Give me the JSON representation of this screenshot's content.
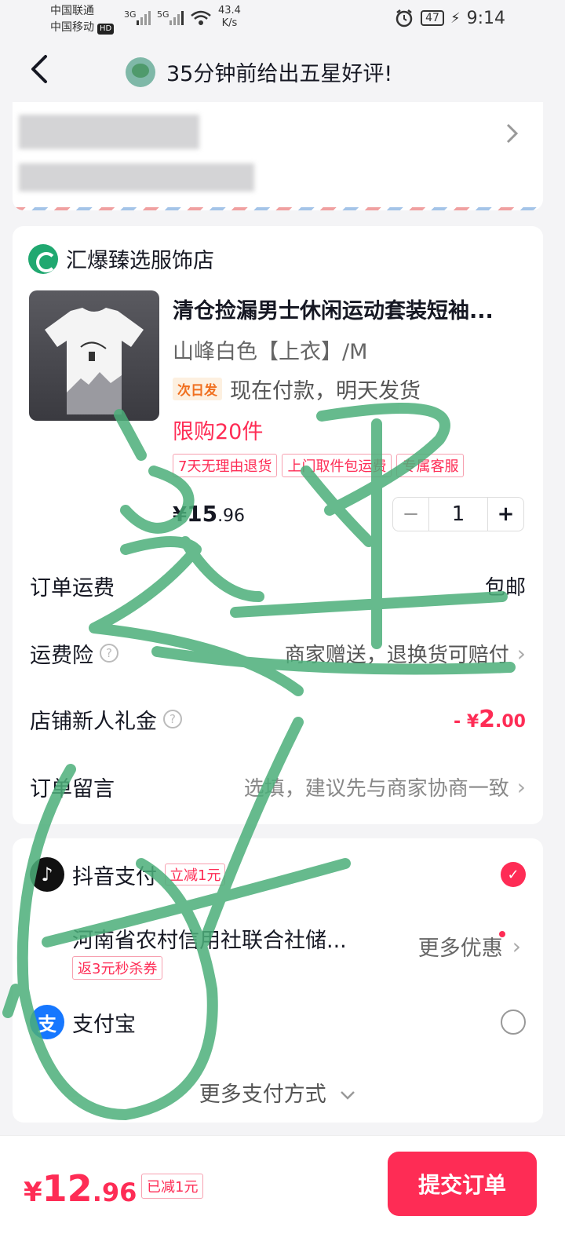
{
  "status_bar": {
    "carrier_1": "中国联通",
    "carrier_2": "中国移动",
    "hd_badge": "HD",
    "net_1": "3G",
    "net_2": "5G",
    "speed_value": "43.4",
    "speed_unit": "K/s",
    "battery": "47",
    "time": "9:14"
  },
  "nav": {
    "title": "35分钟前给出五星好评!"
  },
  "shop": {
    "name": "汇爆臻选服饰店",
    "product": {
      "title": "清仓捡漏男士休闲运动套装短袖...",
      "spec": "山峰白色【上衣】/M",
      "shipping_badge": "次日发",
      "shipping_text": "现在付款，明天发货",
      "limit": "限购20件",
      "tags": [
        "7天无理由退货",
        "上门取件包运费",
        "专属客服"
      ],
      "price_currency": "¥",
      "price_int": "15",
      "price_dec": ".96",
      "quantity": "1",
      "minus": "−",
      "plus": "+"
    },
    "rows": {
      "shipping_fee_label": "订单运费",
      "shipping_fee_value": "包邮",
      "insurance_label": "运费险",
      "insurance_value": "商家赠送，退换货可赔付",
      "gift_label": "店铺新人礼金",
      "gift_value_prefix": "- ¥",
      "gift_value_int": "2",
      "gift_value_dec": ".00",
      "note_label": "订单留言",
      "note_placeholder": "选填，建议先与商家协商一致",
      "help_glyph": "?"
    }
  },
  "payment": {
    "douyin_name": "抖音支付",
    "douyin_tag": "立减1元",
    "bank_name": "河南省农村信用社联合社储...",
    "bank_tag": "返3元秒杀券",
    "more_discount": "更多优惠",
    "alipay_name": "支付宝",
    "more_methods": "更多支付方式"
  },
  "bottom": {
    "total_currency": "¥",
    "total_int": "12",
    "total_dec": ".96",
    "saved": "已减1元",
    "submit": "提交订单"
  },
  "icons": {
    "back": "back-arrow-icon",
    "chevron": "chevron-right-icon",
    "check": "check-icon",
    "douyin": "douyin-pay-icon",
    "alipay": "alipay-icon",
    "expand": "chevron-down-icon"
  },
  "colors": {
    "accent": "#fe2c55",
    "scribble": "#4caf7a",
    "shop_logo": "#20a870",
    "alipay": "#1677ff"
  }
}
